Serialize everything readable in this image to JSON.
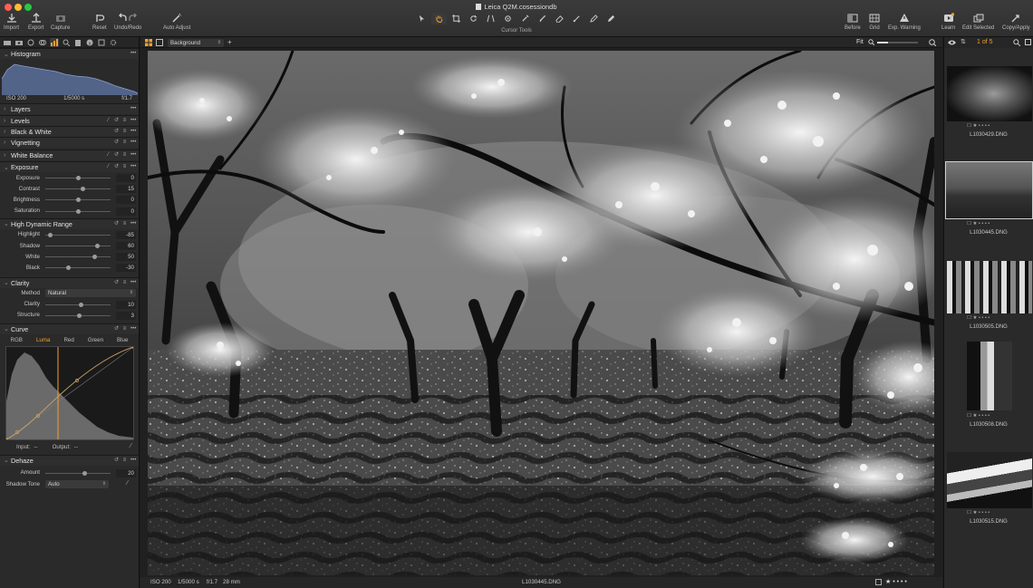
{
  "window": {
    "title": "Leica Q2M.cosessiondb",
    "traffic_colors": [
      "#ff5f57",
      "#febc2e",
      "#28c840"
    ]
  },
  "toolbar": {
    "left": [
      {
        "label": "Import",
        "icon": "import-icon"
      },
      {
        "label": "Export",
        "icon": "export-icon"
      },
      {
        "label": "Capture",
        "icon": "camera-icon"
      },
      {
        "label": "Reset",
        "icon": "reset-icon"
      },
      {
        "label": "Undo/Redo",
        "icon": "undo-redo-icon"
      },
      {
        "label": "Auto Adjust",
        "icon": "magic-wand-icon"
      }
    ],
    "cursor_tools_label": "Cursor Tools",
    "right": [
      {
        "label": "Before",
        "icon": "before-icon"
      },
      {
        "label": "Grid",
        "icon": "grid-icon"
      },
      {
        "label": "Exp. Warning",
        "icon": "warning-icon"
      },
      {
        "label": "Learn",
        "icon": "learn-icon"
      },
      {
        "label": "Edit Selected",
        "icon": "edit-selected-icon"
      },
      {
        "label": "Copy/Apply",
        "icon": "copy-apply-icon"
      }
    ]
  },
  "left_panel": {
    "histogram": {
      "title": "Histogram",
      "iso": "ISO 200",
      "shutter": "1/5000 s",
      "aperture": "f/1.7"
    },
    "sections": {
      "layers": "Layers",
      "levels": "Levels",
      "bw": "Black & White",
      "vignetting": "Vignetting",
      "white_balance": "White Balance",
      "exposure": "Exposure",
      "hdr": "High Dynamic Range",
      "clarity": "Clarity",
      "curve": "Curve",
      "dehaze": "Dehaze"
    },
    "exposure": [
      {
        "label": "Exposure",
        "value": "0",
        "pos": 0.5
      },
      {
        "label": "Contrast",
        "value": "15",
        "pos": 0.575
      },
      {
        "label": "Brightness",
        "value": "0",
        "pos": 0.5
      },
      {
        "label": "Saturation",
        "value": "0",
        "pos": 0.5
      }
    ],
    "hdr": [
      {
        "label": "Highlight",
        "value": "-85",
        "pos": 0.075
      },
      {
        "label": "Shadow",
        "value": "60",
        "pos": 0.8
      },
      {
        "label": "White",
        "value": "50",
        "pos": 0.75
      },
      {
        "label": "Black",
        "value": "-30",
        "pos": 0.35
      }
    ],
    "clarity": {
      "method_label": "Method",
      "method_value": "Natural",
      "sliders": [
        {
          "label": "Clarity",
          "value": "10",
          "pos": 0.55
        },
        {
          "label": "Structure",
          "value": "3",
          "pos": 0.515
        }
      ]
    },
    "curve": {
      "tabs": [
        "RGB",
        "Luma",
        "Red",
        "Green",
        "Blue"
      ],
      "selected": "Luma",
      "input_label": "Input:",
      "input_value": "--",
      "output_label": "Output:",
      "output_value": "--"
    },
    "dehaze": {
      "amount_label": "Amount",
      "amount_value": "20",
      "amount_pos": 0.6,
      "shadow_label": "Shadow Tone",
      "shadow_value": "Auto"
    }
  },
  "viewer": {
    "layer_select": "Background",
    "zoom": "Fit",
    "status": {
      "iso": "ISO 200",
      "shutter": "1/5000 s",
      "aperture": "f/1.7",
      "focal": "28 mm",
      "filename": "L1030445.DNG"
    }
  },
  "filmstrip": {
    "count": "1 of 5",
    "items": [
      {
        "name": "L1030429.DNG",
        "selected": false
      },
      {
        "name": "L1030445.DNG",
        "selected": true
      },
      {
        "name": "L1030505.DNG",
        "selected": false
      },
      {
        "name": "L1030508.DNG",
        "selected": false
      },
      {
        "name": "L1030515.DNG",
        "selected": false
      }
    ]
  },
  "colors": {
    "accent": "#f0a030",
    "panel": "#2a2a2a",
    "header": "#2e2e2e",
    "background": "#1e1e1e"
  }
}
